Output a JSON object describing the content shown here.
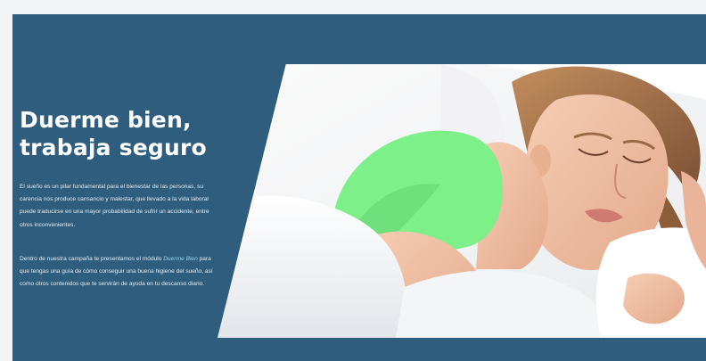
{
  "hero": {
    "title_line1": "Duerme bien,",
    "title_line2": "trabaja seguro",
    "paragraph1": "El sueño es un pilar fundamental para el bienestar de las personas, su carencia nos produce cansancio y malestar, que llevado a la vida laboral puede traducirse en una mayor probabilidad de sufrir un accidente, entre otros inconvenientes.",
    "paragraph2_before": "Dentro de nuestra campaña te presentamos el módulo ",
    "paragraph2_link": "Duerme Bien",
    "paragraph2_after": " para que tengas una guía de cómo conseguir una buena higiene del sueño, así como otros contenidos que te servirán de ayuda en tu descanso diario.",
    "image_subject": "woman-sleeping-photo"
  },
  "colors": {
    "page_background": "#f2f3f4",
    "banner_background": "#2f5d7e",
    "title_text": "#ffffff",
    "body_text": "#e4ecf2",
    "highlight_text": "#8fd4ee",
    "shirt_green": "#7ef08a"
  }
}
